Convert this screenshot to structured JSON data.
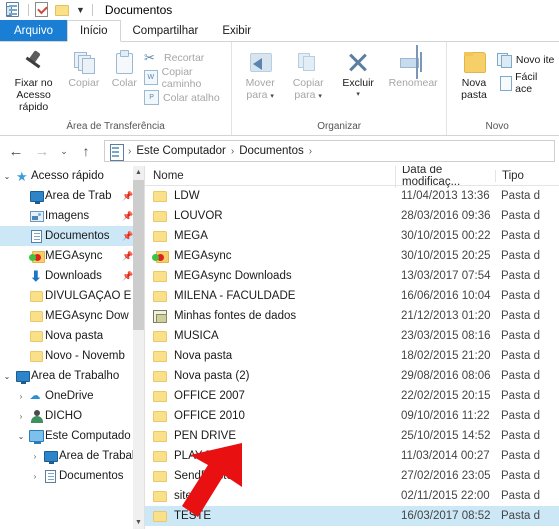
{
  "window": {
    "title": "Documentos",
    "quick_access_icons": [
      "document-icon",
      "properties-icon",
      "folder-icon",
      "dropdown-caret-icon"
    ]
  },
  "ribbon": {
    "tabs": [
      {
        "label": "Arquivo",
        "id": "file",
        "style": "file"
      },
      {
        "label": "Início",
        "id": "home",
        "style": "active"
      },
      {
        "label": "Compartilhar",
        "id": "share",
        "style": "normal"
      },
      {
        "label": "Exibir",
        "id": "view",
        "style": "normal"
      }
    ],
    "groups": [
      {
        "name": "Área de Transferência",
        "big_buttons": [
          {
            "label_line1": "Fixar no",
            "label_line2": "Acesso rápido",
            "icon": "pin-icon",
            "disabled": false
          },
          {
            "label_line1": "Copiar",
            "label_line2": "",
            "icon": "copy-icon",
            "disabled": true
          },
          {
            "label_line1": "Colar",
            "label_line2": "",
            "icon": "paste-icon",
            "disabled": true
          }
        ],
        "small_buttons": [
          {
            "label": "Recortar",
            "icon": "scissors-icon",
            "disabled": true
          },
          {
            "label": "Copiar caminho",
            "icon": "copy-path-icon",
            "disabled": true
          },
          {
            "label": "Colar atalho",
            "icon": "paste-shortcut-icon",
            "disabled": true
          }
        ]
      },
      {
        "name": "Organizar",
        "big_buttons": [
          {
            "label_line1": "Mover",
            "label_line2": "para",
            "icon": "move-to-icon",
            "disabled": true
          },
          {
            "label_line1": "Copiar",
            "label_line2": "para",
            "icon": "copy-to-icon",
            "disabled": true
          },
          {
            "label_line1": "Excluir",
            "label_line2": "",
            "icon": "delete-icon",
            "disabled": false
          },
          {
            "label_line1": "Renomear",
            "label_line2": "",
            "icon": "rename-icon",
            "disabled": true
          }
        ],
        "small_buttons": []
      },
      {
        "name": "Novo",
        "big_buttons": [
          {
            "label_line1": "Nova",
            "label_line2": "pasta",
            "icon": "new-folder-icon",
            "disabled": false
          }
        ],
        "small_buttons": [
          {
            "label": "Novo ite",
            "icon": "new-item-icon",
            "disabled": false
          },
          {
            "label": "Fácil ace",
            "icon": "easy-access-icon",
            "disabled": false
          }
        ]
      }
    ]
  },
  "address_bar": {
    "back_icon": "back-arrow-icon",
    "forward_icon": "forward-arrow-icon",
    "recent_icon": "recent-locations-icon",
    "up_icon": "up-arrow-icon",
    "path_icon": "documents-icon",
    "crumbs": [
      "Este Computador",
      "Documentos"
    ]
  },
  "sidebar": {
    "items": [
      {
        "label": "Acesso rápido",
        "icon": "star-icon",
        "indent": 0,
        "chevron": "open",
        "pin": false,
        "selected": false
      },
      {
        "label": "Área de Trab",
        "icon": "desktop-icon",
        "indent": 1,
        "chevron": "none",
        "pin": true,
        "selected": false
      },
      {
        "label": "Imagens",
        "icon": "pictures-icon",
        "indent": 1,
        "chevron": "none",
        "pin": true,
        "selected": false
      },
      {
        "label": "Documentos",
        "icon": "documents-icon",
        "indent": 1,
        "chevron": "none",
        "pin": true,
        "selected": true
      },
      {
        "label": "MEGAsync",
        "icon": "megasync-folder-icon",
        "indent": 1,
        "chevron": "none",
        "pin": true,
        "selected": false
      },
      {
        "label": "Downloads",
        "icon": "downloads-icon",
        "indent": 1,
        "chevron": "none",
        "pin": true,
        "selected": false
      },
      {
        "label": "DIVULGAÇÃO E",
        "icon": "folder-icon",
        "indent": 1,
        "chevron": "none",
        "pin": false,
        "selected": false
      },
      {
        "label": "MEGAsync Dow",
        "icon": "folder-icon",
        "indent": 1,
        "chevron": "none",
        "pin": false,
        "selected": false
      },
      {
        "label": "Nova pasta",
        "icon": "folder-icon",
        "indent": 1,
        "chevron": "none",
        "pin": false,
        "selected": false
      },
      {
        "label": "Novo - Novemb",
        "icon": "folder-icon",
        "indent": 1,
        "chevron": "none",
        "pin": false,
        "selected": false
      },
      {
        "label": "Área de Trabalho",
        "icon": "desktop-icon",
        "indent": 0,
        "chevron": "open",
        "pin": false,
        "selected": false
      },
      {
        "label": "OneDrive",
        "icon": "onedrive-icon",
        "indent": 1,
        "chevron": "closed",
        "pin": false,
        "selected": false
      },
      {
        "label": "DICHO",
        "icon": "user-icon",
        "indent": 1,
        "chevron": "closed",
        "pin": false,
        "selected": false
      },
      {
        "label": "Este Computado",
        "icon": "this-pc-icon",
        "indent": 1,
        "chevron": "open",
        "pin": false,
        "selected": false
      },
      {
        "label": "Área de Trabal",
        "icon": "desktop-icon",
        "indent": 2,
        "chevron": "closed",
        "pin": false,
        "selected": false
      },
      {
        "label": "Documentos",
        "icon": "documents-icon",
        "indent": 2,
        "chevron": "closed",
        "pin": false,
        "selected": false
      }
    ]
  },
  "file_list": {
    "columns": [
      "Nome",
      "Data de modificaç...",
      "Tipo"
    ],
    "rows": [
      {
        "name": "LDW",
        "date": "11/04/2013 13:36",
        "type": "Pasta d",
        "icon": "folder-icon",
        "selected": false
      },
      {
        "name": "LOUVOR",
        "date": "28/03/2016 09:36",
        "type": "Pasta d",
        "icon": "folder-icon",
        "selected": false
      },
      {
        "name": "MEGA",
        "date": "30/10/2015 00:22",
        "type": "Pasta d",
        "icon": "folder-icon",
        "selected": false
      },
      {
        "name": "MEGAsync",
        "date": "30/10/2015 20:25",
        "type": "Pasta d",
        "icon": "megasync-folder-icon",
        "selected": false
      },
      {
        "name": "MEGAsync Downloads",
        "date": "13/03/2017 07:54",
        "type": "Pasta d",
        "icon": "folder-icon",
        "selected": false
      },
      {
        "name": "MILENA - FACULDADE",
        "date": "16/06/2016 10:04",
        "type": "Pasta d",
        "icon": "folder-icon",
        "selected": false
      },
      {
        "name": "Minhas fontes de dados",
        "date": "21/12/2013 01:20",
        "type": "Pasta d",
        "icon": "data-sources-icon",
        "selected": false
      },
      {
        "name": "MUSICA",
        "date": "23/03/2015 08:16",
        "type": "Pasta d",
        "icon": "folder-icon",
        "selected": false
      },
      {
        "name": "Nova pasta",
        "date": "18/02/2015 21:20",
        "type": "Pasta d",
        "icon": "folder-icon",
        "selected": false
      },
      {
        "name": "Nova pasta (2)",
        "date": "29/08/2016 08:06",
        "type": "Pasta d",
        "icon": "folder-icon",
        "selected": false
      },
      {
        "name": "OFFICE 2007",
        "date": "22/02/2015 20:15",
        "type": "Pasta d",
        "icon": "folder-icon",
        "selected": false
      },
      {
        "name": "OFFICE 2010",
        "date": "09/10/2016 11:22",
        "type": "Pasta d",
        "icon": "folder-icon",
        "selected": false
      },
      {
        "name": "PEN DRIVE",
        "date": "25/10/2015 14:52",
        "type": "Pasta d",
        "icon": "folder-icon",
        "selected": false
      },
      {
        "name": "PLAY BACK",
        "date": "11/03/2014 00:27",
        "type": "Pasta d",
        "icon": "folder-icon",
        "selected": false
      },
      {
        "name": "SendBlaster",
        "date": "27/02/2016 23:05",
        "type": "Pasta d",
        "icon": "folder-icon",
        "selected": false
      },
      {
        "name": "site",
        "date": "02/11/2015 22:00",
        "type": "Pasta d",
        "icon": "folder-icon",
        "selected": false
      },
      {
        "name": "TESTE",
        "date": "16/03/2017 08:52",
        "type": "Pasta d",
        "icon": "folder-icon",
        "selected": true
      }
    ]
  },
  "annotation": {
    "type": "red-arrow",
    "color": "#e81010",
    "points_to": "TESTE"
  },
  "colors": {
    "file_tab": "#1a7fd4",
    "selection": "#cce8f7",
    "folder": "#fbe08a",
    "annotation_red": "#e81010"
  }
}
